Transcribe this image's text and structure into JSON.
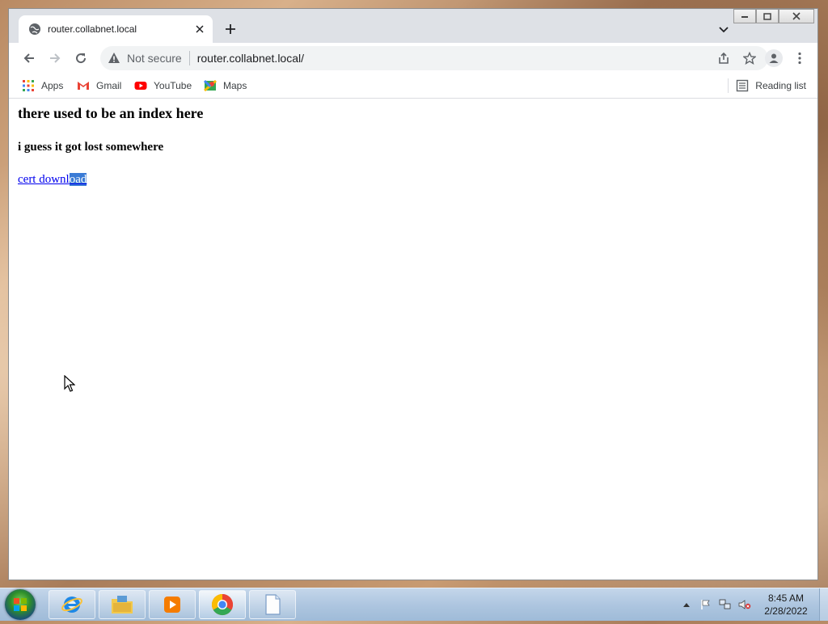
{
  "browser": {
    "tab": {
      "title": "router.collabnet.local"
    },
    "omnibox": {
      "security_label": "Not secure",
      "url": "router.collabnet.local/"
    },
    "bookmarks": [
      {
        "label": "Apps",
        "icon": "apps-grid-icon"
      },
      {
        "label": "Gmail",
        "icon": "gmail-icon"
      },
      {
        "label": "YouTube",
        "icon": "youtube-icon"
      },
      {
        "label": "Maps",
        "icon": "maps-icon"
      }
    ],
    "reading_list": "Reading list"
  },
  "page": {
    "heading": "there used to be an index here",
    "subheading": "i guess it got lost somewhere",
    "link_text_unselected": "cert downl",
    "link_text_selected": "oad"
  },
  "taskbar": {
    "apps": [
      "internet-explorer-icon",
      "file-explorer-icon",
      "media-player-icon",
      "chrome-icon",
      "document-icon"
    ],
    "active_app": "chrome-icon",
    "time": "8:45 AM",
    "date": "2/28/2022"
  },
  "colors": {
    "link": "#0000ee",
    "selection": "#3a7bd5",
    "tabstrip": "#dee1e6",
    "omnibox": "#f1f3f4"
  }
}
